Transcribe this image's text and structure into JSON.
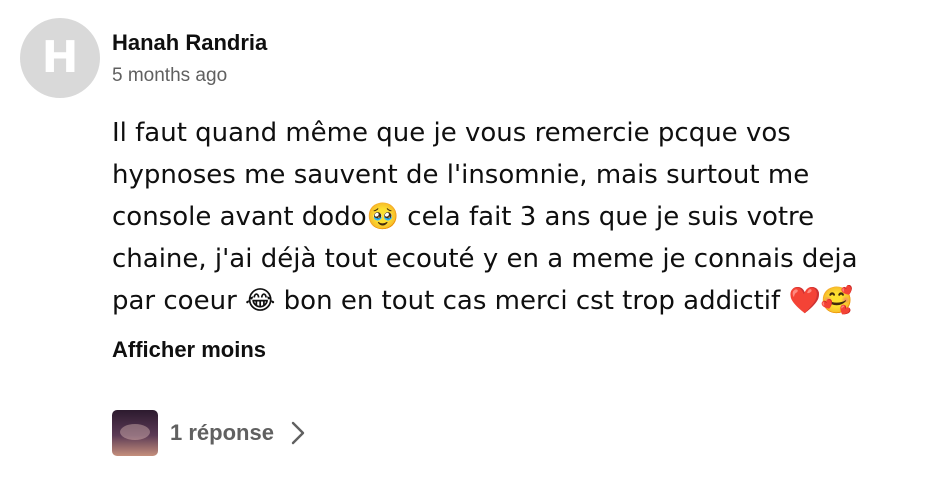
{
  "comment": {
    "avatar_letter": "H",
    "author": "Hanah Randria",
    "time": "5 months ago",
    "text": "Il faut quand même que je vous remercie pcque vos\nhypnoses me sauvent de l'insomnie, mais surtout me\nconsole avant dodo🥹 cela fait 3 ans que je suis votre\nchaine, j'ai déjà tout ecouté y en a meme je connais deja\npar coeur 😂 bon en tout cas merci cst trop addictif ❤️🥰",
    "show_less_label": "Afficher moins",
    "replies": {
      "label": "1 réponse",
      "thumbnail_icon": "channel-thumbnail-icon",
      "chevron_icon": "chevron-right-icon"
    }
  }
}
